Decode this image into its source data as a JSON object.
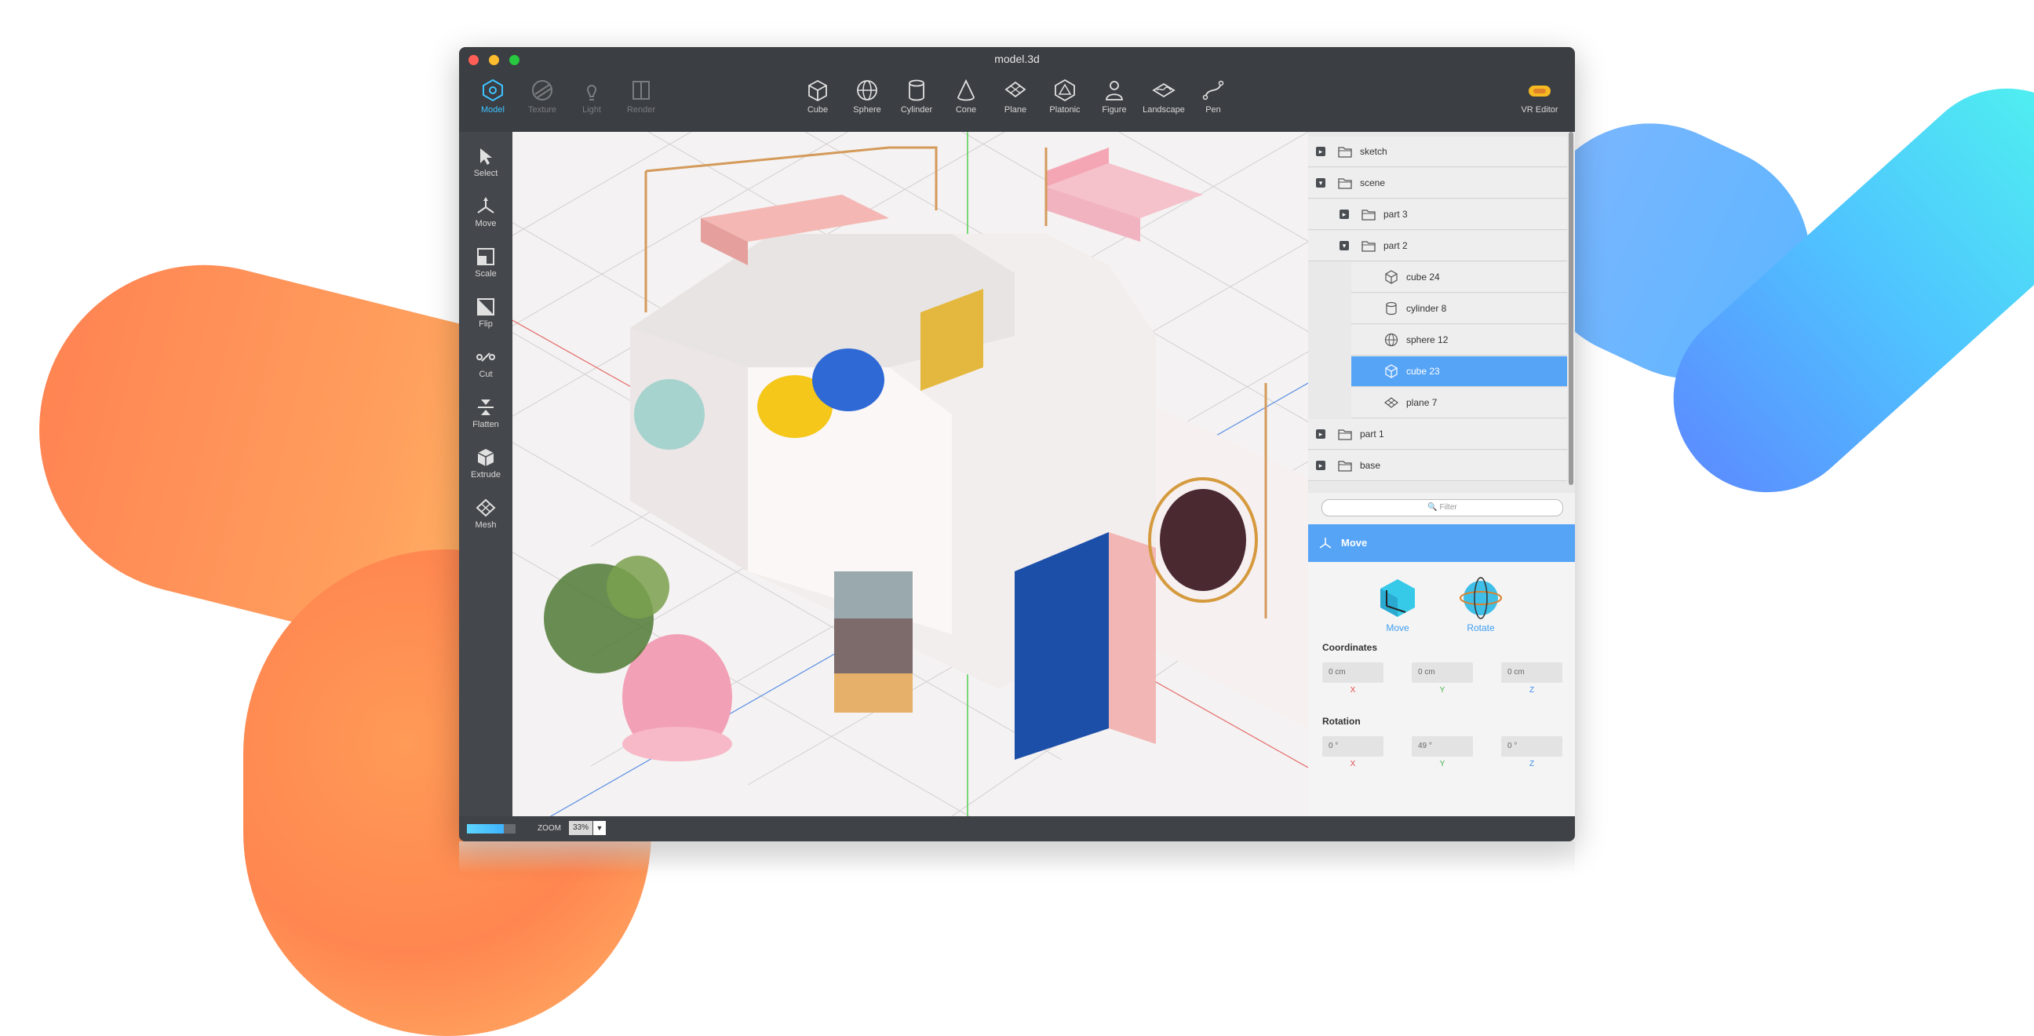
{
  "window": {
    "title": "model.3d"
  },
  "toolbar": {
    "modes": [
      {
        "label": "Model",
        "icon": "model-icon",
        "state": "active"
      },
      {
        "label": "Texture",
        "icon": "texture-icon",
        "state": "disabled"
      },
      {
        "label": "Light",
        "icon": "light-icon",
        "state": "disabled"
      },
      {
        "label": "Render",
        "icon": "render-icon",
        "state": "disabled"
      }
    ],
    "shapes": [
      {
        "label": "Cube",
        "icon": "cube-icon"
      },
      {
        "label": "Sphere",
        "icon": "sphere-icon"
      },
      {
        "label": "Cylinder",
        "icon": "cylinder-icon"
      },
      {
        "label": "Cone",
        "icon": "cone-icon"
      },
      {
        "label": "Plane",
        "icon": "plane-icon"
      },
      {
        "label": "Platonic",
        "icon": "platonic-icon"
      },
      {
        "label": "Figure",
        "icon": "figure-icon"
      },
      {
        "label": "Landscape",
        "icon": "landscape-icon"
      },
      {
        "label": "Pen",
        "icon": "pen-icon"
      }
    ],
    "vr_label": "VR Editor"
  },
  "left_tools": [
    {
      "label": "Select",
      "icon": "select-icon"
    },
    {
      "label": "Move",
      "icon": "move-icon"
    },
    {
      "label": "Scale",
      "icon": "scale-icon"
    },
    {
      "label": "Flip",
      "icon": "flip-icon"
    },
    {
      "label": "Cut",
      "icon": "cut-icon"
    },
    {
      "label": "Flatten",
      "icon": "flatten-icon"
    },
    {
      "label": "Extrude",
      "icon": "extrude-icon"
    },
    {
      "label": "Mesh",
      "icon": "mesh-icon"
    }
  ],
  "scene_tree": [
    {
      "label": "sketch",
      "type": "folder",
      "expander": "+"
    },
    {
      "label": "scene",
      "type": "folder",
      "expander": "−"
    },
    {
      "label": "part 3",
      "type": "folder",
      "expander": "+"
    },
    {
      "label": "part 2",
      "type": "folder",
      "expander": "−"
    },
    {
      "label": "cube 24",
      "type": "cube"
    },
    {
      "label": "cylinder 8",
      "type": "cylinder"
    },
    {
      "label": "sphere 12",
      "type": "sphere"
    },
    {
      "label": "cube 23",
      "type": "cube",
      "selected": true
    },
    {
      "label": "plane 7",
      "type": "plane"
    },
    {
      "label": "part 1",
      "type": "folder",
      "expander": "+"
    },
    {
      "label": "base",
      "type": "folder",
      "expander": "+"
    }
  ],
  "filter": {
    "placeholder": "Filter"
  },
  "properties": {
    "header": "Move",
    "tools": [
      {
        "label": "Move",
        "icon": "move-cube-icon"
      },
      {
        "label": "Rotate",
        "icon": "rotate-sphere-icon"
      }
    ],
    "coordinates_title": "Coordinates",
    "coordinates": [
      {
        "value": "0 cm",
        "axis": "X"
      },
      {
        "value": "0 cm",
        "axis": "Y"
      },
      {
        "value": "0 cm",
        "axis": "Z"
      }
    ],
    "rotation_title": "Rotation",
    "rotation": [
      {
        "value": "0 °",
        "axis": "X"
      },
      {
        "value": "49 °",
        "axis": "Y"
      },
      {
        "value": "0 °",
        "axis": "Z"
      }
    ]
  },
  "status": {
    "zoom_label": "ZOOM",
    "zoom_value": "33%",
    "progress": 0.75
  },
  "colors": {
    "accent": "#3fc3ff",
    "selection": "#56a4f6",
    "axis_x": "#e34a4a",
    "axis_y": "#48b04c",
    "axis_z": "#3f8ef2"
  }
}
